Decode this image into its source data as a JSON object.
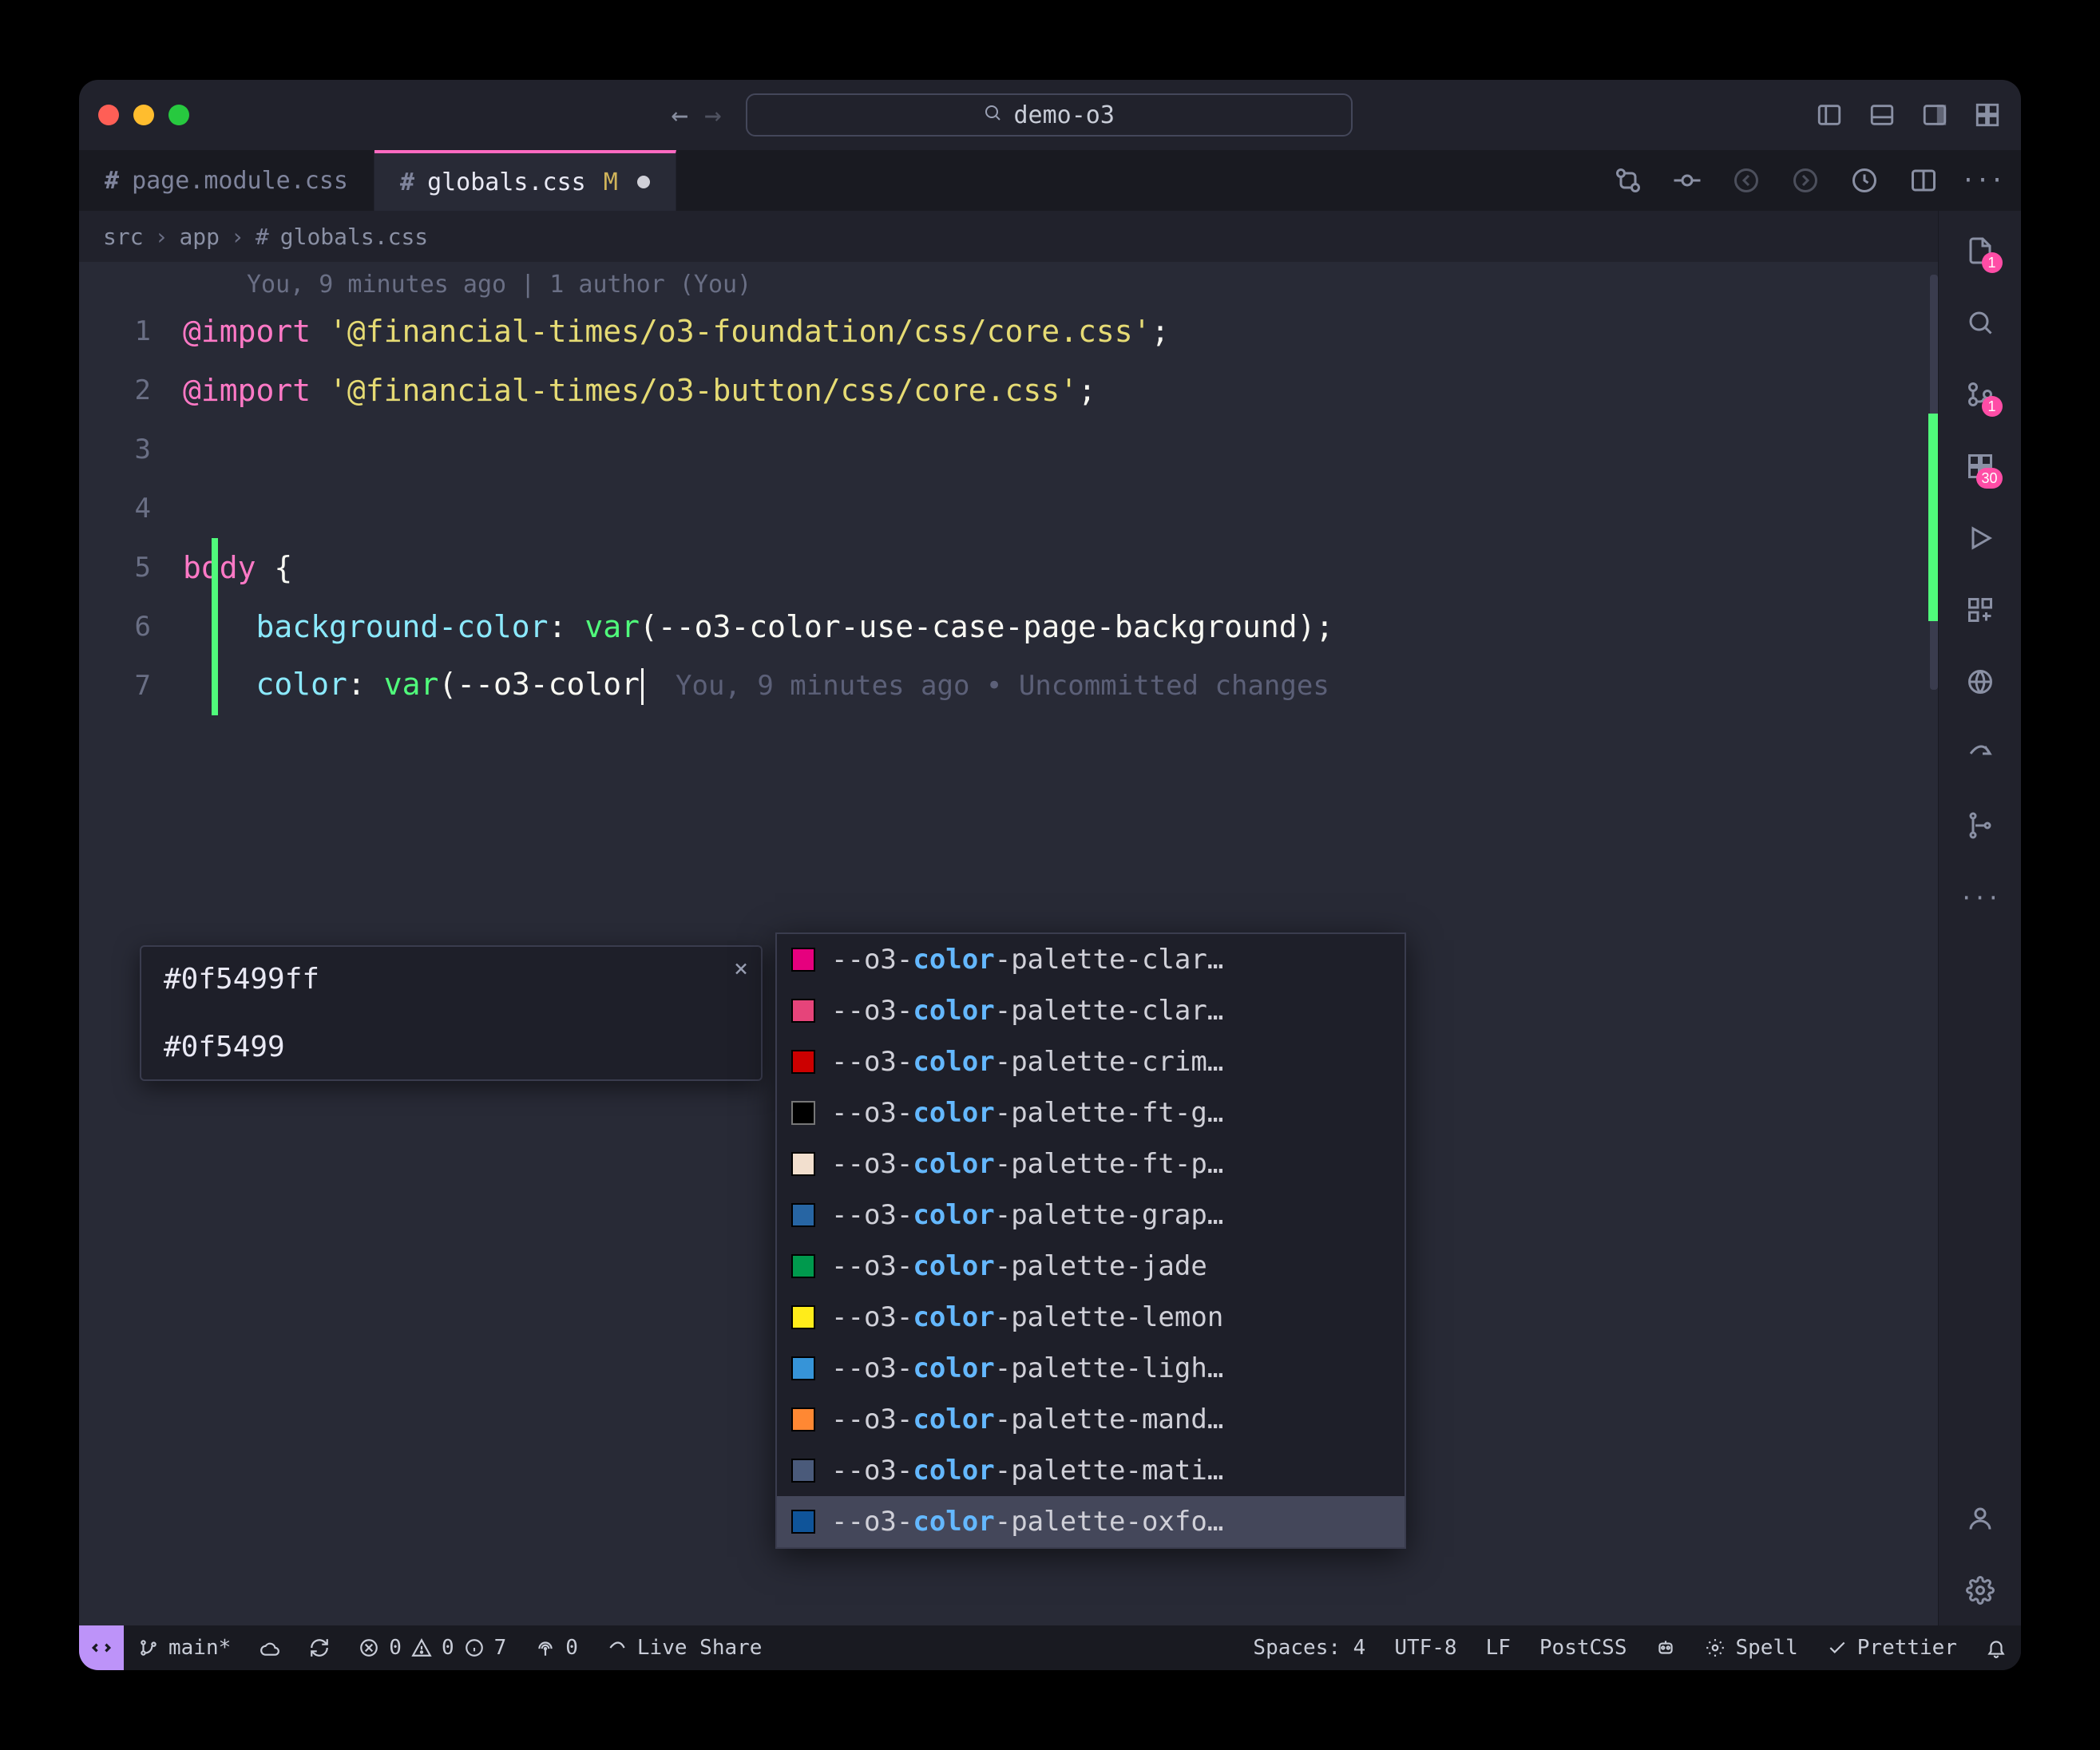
{
  "window": {
    "search_label": "demo-o3"
  },
  "tabs": [
    {
      "label": "page.module.css",
      "active": false,
      "modified": false
    },
    {
      "label": "globals.css",
      "active": true,
      "modified": true,
      "modified_marker": "M"
    }
  ],
  "breadcrumbs": {
    "seg1": "src",
    "seg2": "app",
    "seg3": "globals.css"
  },
  "blame": {
    "header": "You, 9 minutes ago | 1 author (You)",
    "inline": "You, 9 minutes ago • Uncommitted changes"
  },
  "code": {
    "l1_kw": "@import",
    "l1_str": "'@financial-times/o3-foundation/css/core.css'",
    "l1_end": ";",
    "l2_kw": "@import",
    "l2_str": "'@financial-times/o3-button/css/core.css'",
    "l2_end": ";",
    "l5_sel": "body",
    "l5_brace": "{",
    "l6_prop": "background-color",
    "l6_colon": ":",
    "l6_func": "var",
    "l6_open": "(",
    "l6_var": "--o3-color-use-case-page-background",
    "l6_close": ")",
    "l6_end": ";",
    "l7_prop": "color",
    "l7_colon": ":",
    "l7_func": "var",
    "l7_open": "(",
    "l7_var": "--o3-color"
  },
  "linenos": {
    "n1": "1",
    "n2": "2",
    "n3": "3",
    "n4": "4",
    "n5": "5",
    "n6": "6",
    "n7": "7"
  },
  "hover": {
    "title": "#0f5499ff",
    "body": "#0f5499"
  },
  "autocomplete": {
    "prefix": "--o3-",
    "match": "color",
    "items": [
      {
        "swatch": "#e6007e",
        "rest": "-palette-clar…",
        "selected": false
      },
      {
        "swatch": "#e6447a",
        "rest": "-palette-clar…",
        "selected": false
      },
      {
        "swatch": "#cc0000",
        "rest": "-palette-crim…",
        "selected": false
      },
      {
        "swatch": "#000000",
        "rest": "-palette-ft-g…",
        "selected": false,
        "outline": true
      },
      {
        "swatch": "#f2dfce",
        "rest": "-palette-ft-p…",
        "selected": false
      },
      {
        "swatch": "#2765a3",
        "rest": "-palette-grap…",
        "selected": false
      },
      {
        "swatch": "#00994d",
        "rest": "-palette-jade",
        "selected": false
      },
      {
        "swatch": "#ffec1a",
        "rest": "-palette-lemon",
        "selected": false
      },
      {
        "swatch": "#3694d8",
        "rest": "-palette-ligh…",
        "selected": false
      },
      {
        "swatch": "#ff8833",
        "rest": "-palette-mand…",
        "selected": false
      },
      {
        "swatch": "#4a5a7a",
        "rest": "-palette-mati…",
        "selected": false
      },
      {
        "swatch": "#0f5499",
        "rest": "-palette-oxfo…",
        "selected": true
      }
    ]
  },
  "rightbar": {
    "files_badge": "1",
    "scm_badge": "1",
    "ext_badge": "30"
  },
  "status": {
    "branch": "main*",
    "errors": "0",
    "warnings": "0",
    "info": "7",
    "radio": "0",
    "liveshare": "Live Share",
    "spaces": "Spaces: 4",
    "encoding": "UTF-8",
    "eol": "LF",
    "lang": "PostCSS",
    "spell": "Spell",
    "prettier": "Prettier"
  }
}
